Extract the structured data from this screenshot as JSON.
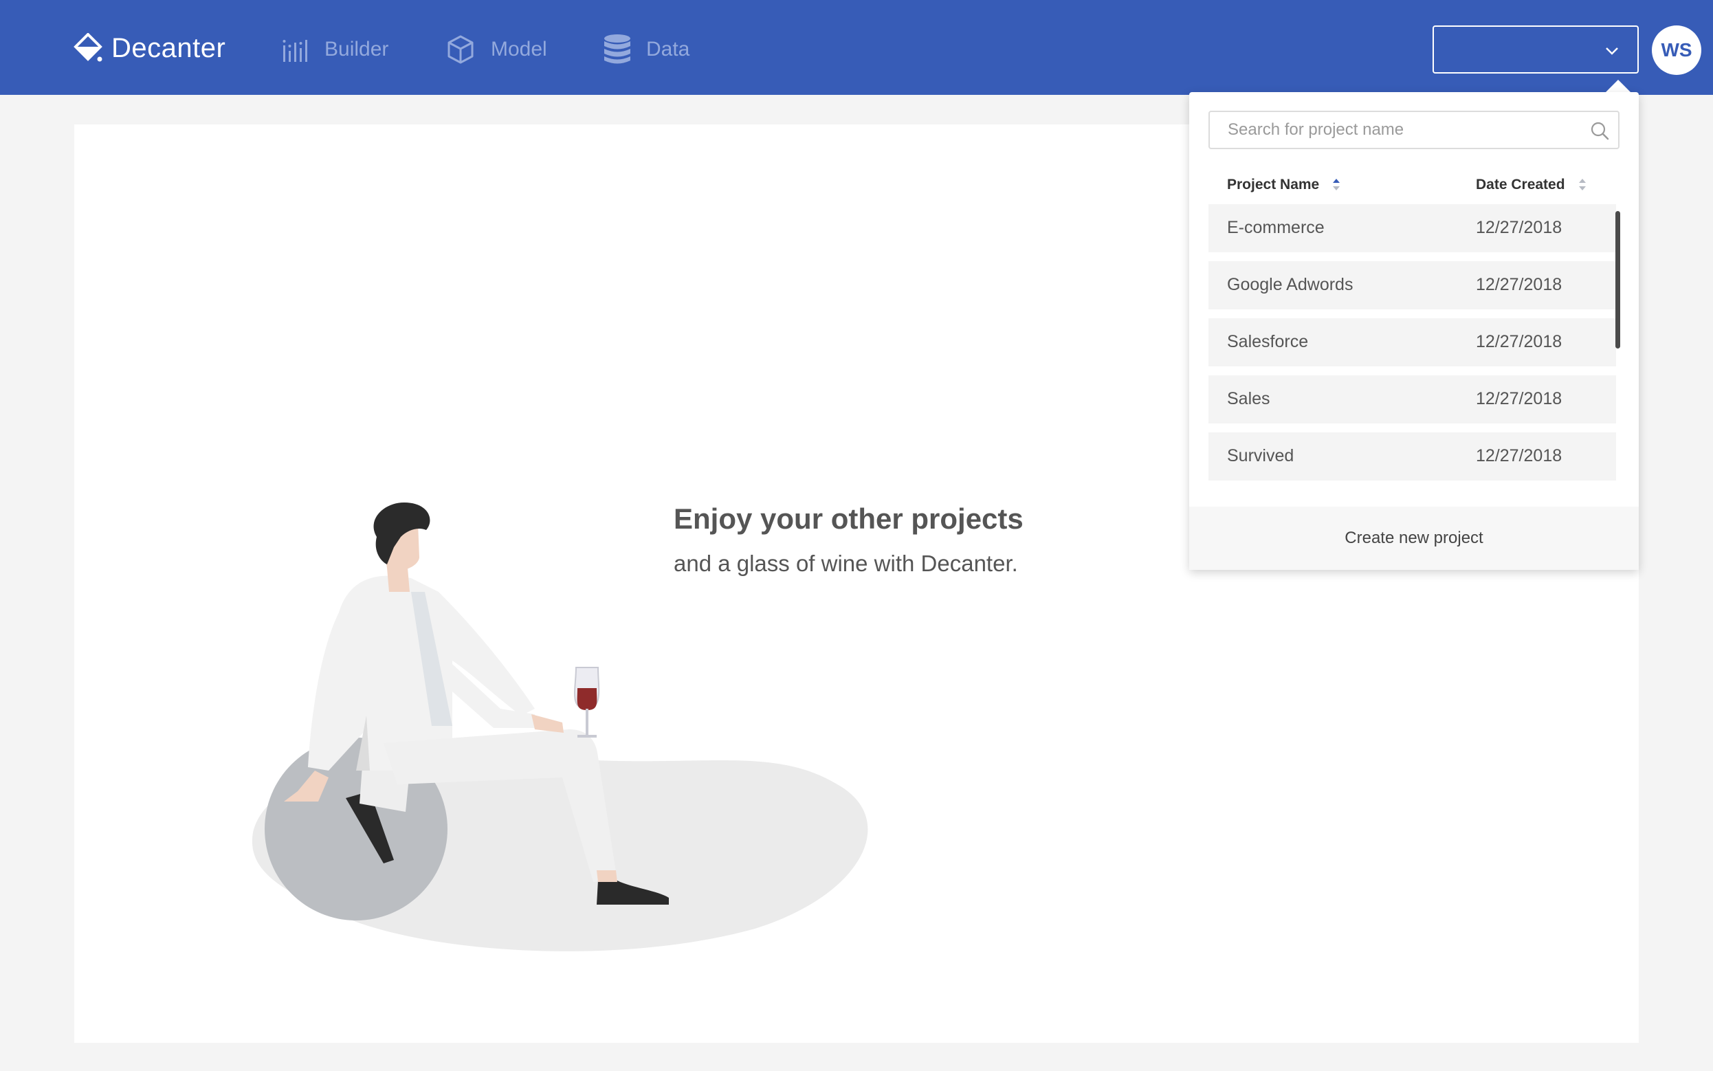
{
  "header": {
    "brand": "Decanter",
    "nav": [
      {
        "label": "Builder",
        "icon": "builder-icon"
      },
      {
        "label": "Model",
        "icon": "cube-icon"
      },
      {
        "label": "Data",
        "icon": "database-icon"
      }
    ],
    "project_select_value": "",
    "avatar_initials": "WS"
  },
  "main": {
    "title": "Enjoy your other projects",
    "subtitle": "and a glass of wine with Decanter."
  },
  "dropdown": {
    "search_placeholder": "Search for project name",
    "columns": {
      "name": "Project Name",
      "date": "Date Created"
    },
    "projects": [
      {
        "name": "E-commerce",
        "date": "12/27/2018"
      },
      {
        "name": "Google Adwords",
        "date": "12/27/2018"
      },
      {
        "name": "Salesforce",
        "date": "12/27/2018"
      },
      {
        "name": "Sales",
        "date": "12/27/2018"
      },
      {
        "name": "Survived",
        "date": "12/27/2018"
      }
    ],
    "footer_label": "Create new project"
  },
  "colors": {
    "brand_blue": "#375cb7",
    "nav_muted": "#93a9dd"
  }
}
